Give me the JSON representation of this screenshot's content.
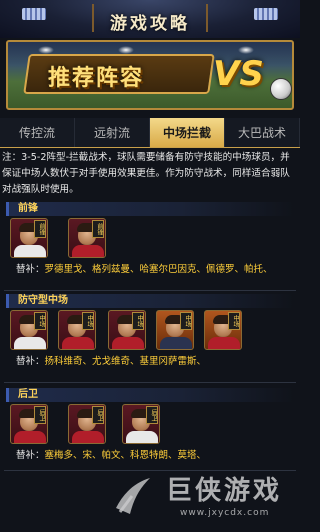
{
  "header": {
    "title": "游戏攻略"
  },
  "banner": {
    "title": "推荐阵容",
    "vs": "VS"
  },
  "tabs": [
    {
      "label": "传控流",
      "active": false
    },
    {
      "label": "远射流",
      "active": false
    },
    {
      "label": "中场拦截",
      "active": true
    },
    {
      "label": "大巴战术",
      "active": false
    }
  ],
  "description": "注：3-5-2阵型-拦截战术，球队需要储备有防守技能的中场球员，并保证中场人数伏于对手使用效果更佳。作为防守战术，同样适合弱队对战强队时使用。",
  "sections": [
    {
      "title": "前锋",
      "cards": [
        {
          "pos": "前锋",
          "variant": "red",
          "shirt": "white"
        },
        {
          "pos": "前锋",
          "variant": "red",
          "shirt": "red"
        }
      ],
      "subs_label": "替补：",
      "subs": "罗德里戈、格列兹曼、哈塞尔巴因克、佩德罗、帕托、"
    },
    {
      "title": "防守型中场",
      "cards": [
        {
          "pos": "中场",
          "variant": "red",
          "shirt": "white"
        },
        {
          "pos": "中场",
          "variant": "red",
          "shirt": "red"
        },
        {
          "pos": "中场",
          "variant": "red",
          "shirt": "red"
        },
        {
          "pos": "中场",
          "variant": "orange",
          "shirt": "dark"
        },
        {
          "pos": "中场",
          "variant": "orange",
          "shirt": "red"
        }
      ],
      "subs_label": "替补：",
      "subs": "扬科维奇、尤戈维奇、基里冈萨雷斯、"
    },
    {
      "title": "后卫",
      "cards": [
        {
          "pos": "后卫",
          "variant": "red",
          "shirt": "red"
        },
        {
          "pos": "后卫",
          "variant": "red",
          "shirt": "red"
        },
        {
          "pos": "后卫",
          "variant": "red",
          "shirt": "white"
        }
      ],
      "subs_label": "替补：",
      "subs": "塞梅多、宋、帕文、科恩特朗、莫塔、"
    }
  ],
  "watermark": {
    "text": "巨侠游戏",
    "url": "www.jxycdx.com"
  },
  "colors": {
    "accent": "#ffd45a",
    "tab_active": "#e3b95c",
    "banner_border": "#b58a3a"
  }
}
